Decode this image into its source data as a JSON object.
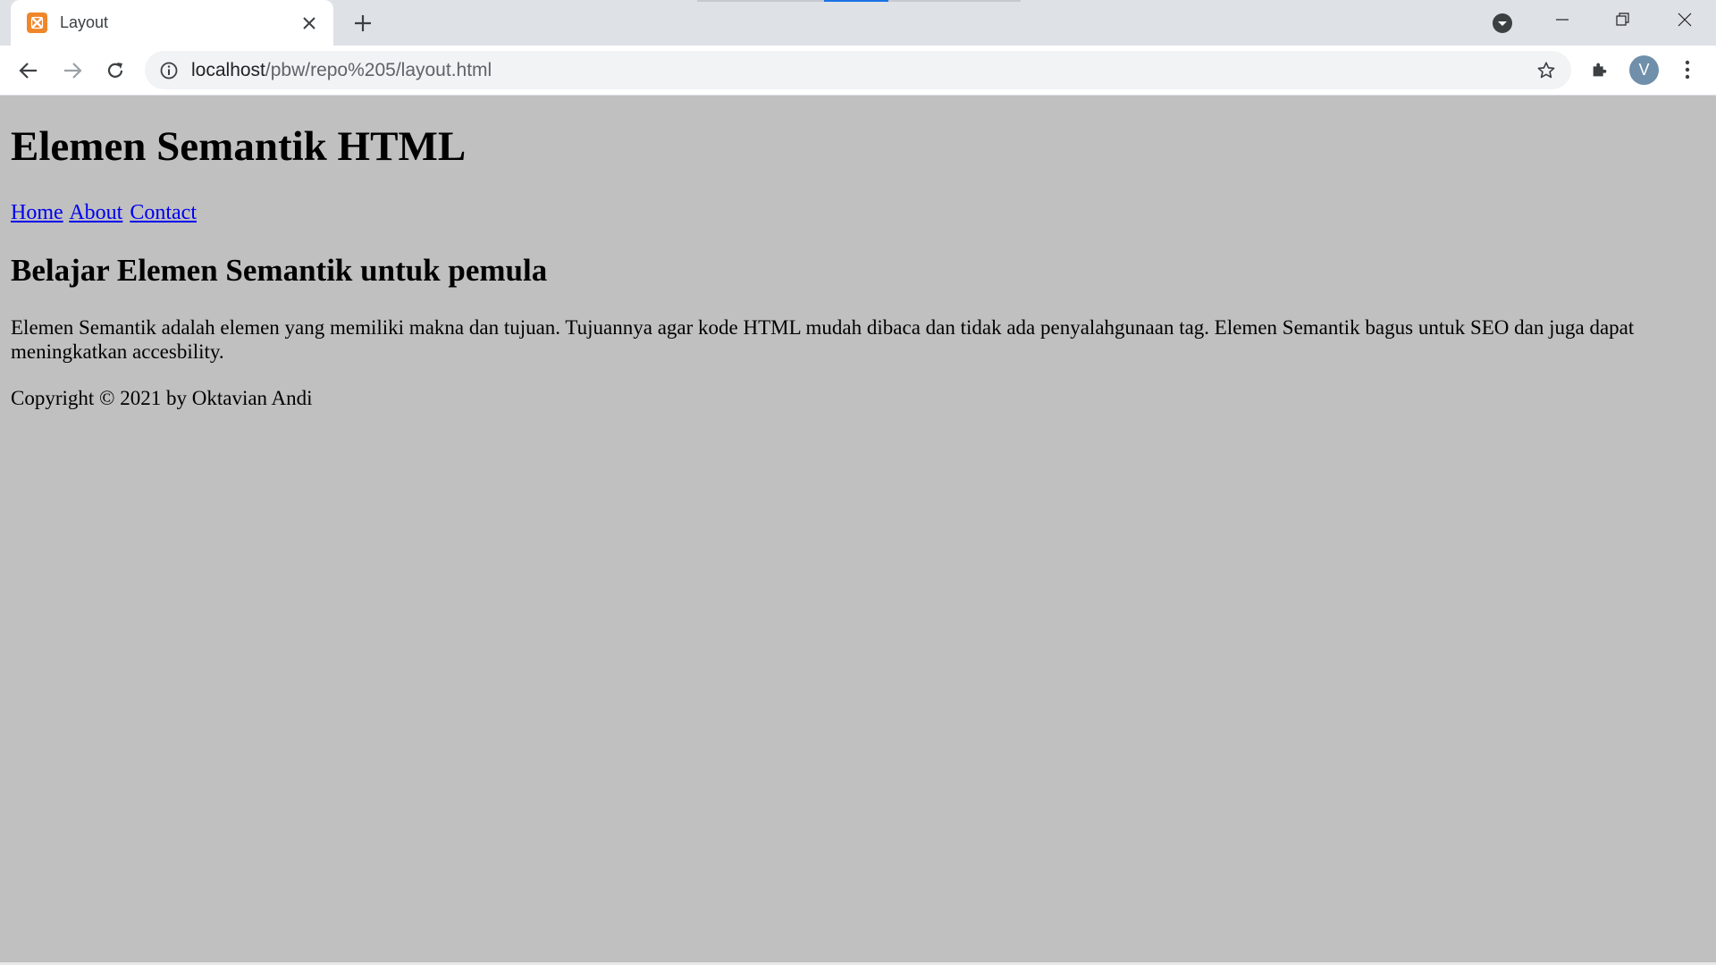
{
  "browser": {
    "tab": {
      "title": "Layout",
      "favicon": "xampp-icon"
    },
    "address_bar": {
      "host": "localhost",
      "path": "/pbw/repo%205/layout.html"
    },
    "profile_initial": "V",
    "colors": {
      "tab_strip": "#dee1e6",
      "accent": "#1a73e8",
      "avatar": "#6f8faa"
    }
  },
  "page": {
    "background": "#c0c0c0",
    "heading": "Elemen Semantik HTML",
    "nav": [
      "Home",
      "About",
      "Contact"
    ],
    "article_title": "Belajar Elemen Semantik untuk pemula",
    "article_body": "Elemen Semantik adalah elemen yang memiliki makna dan tujuan. Tujuannya agar kode HTML mudah dibaca dan tidak ada penyalahgunaan tag. Elemen Semantik bagus untuk SEO dan juga dapat meningkatkan accesbility.",
    "footer": "Copyright © 2021 by Oktavian Andi"
  }
}
